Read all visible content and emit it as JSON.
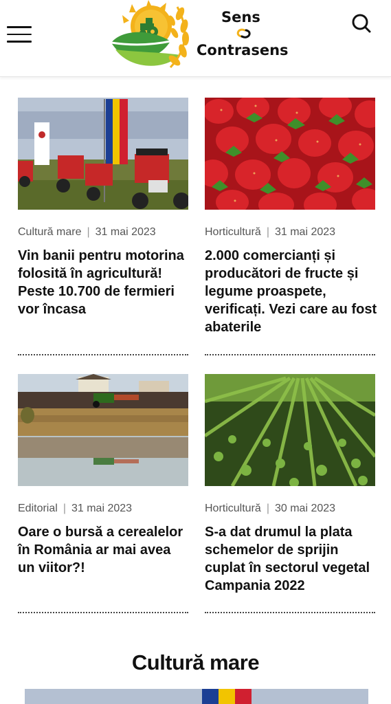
{
  "header": {
    "logo_line1": "Sens",
    "logo_line2": "Contrasens",
    "menu_icon": "hamburger-menu-icon",
    "search_icon": "search-icon"
  },
  "articles": [
    {
      "category": "Cultură mare",
      "date": "31 mai 2023",
      "title": "Vin banii pentru motorina folosită în agricultură! Peste 10.700 de fermieri vor încasa"
    },
    {
      "category": "Horticultură",
      "date": "31 mai 2023",
      "title": "2.000 comercianți și producători de fructe și legume proaspete, verificați. Vezi care au fost abaterile"
    },
    {
      "category": "Editorial",
      "date": "31 mai 2023",
      "title": "Oare o bursă a cerealelor în România ar mai avea un viitor?!"
    },
    {
      "category": "Horticultură",
      "date": "30 mai 2023",
      "title": "S-a dat drumul la plata schemelor de sprijin cuplat în sectorul vegetal Campania 2022"
    }
  ],
  "section": {
    "title": "Cultură mare"
  }
}
